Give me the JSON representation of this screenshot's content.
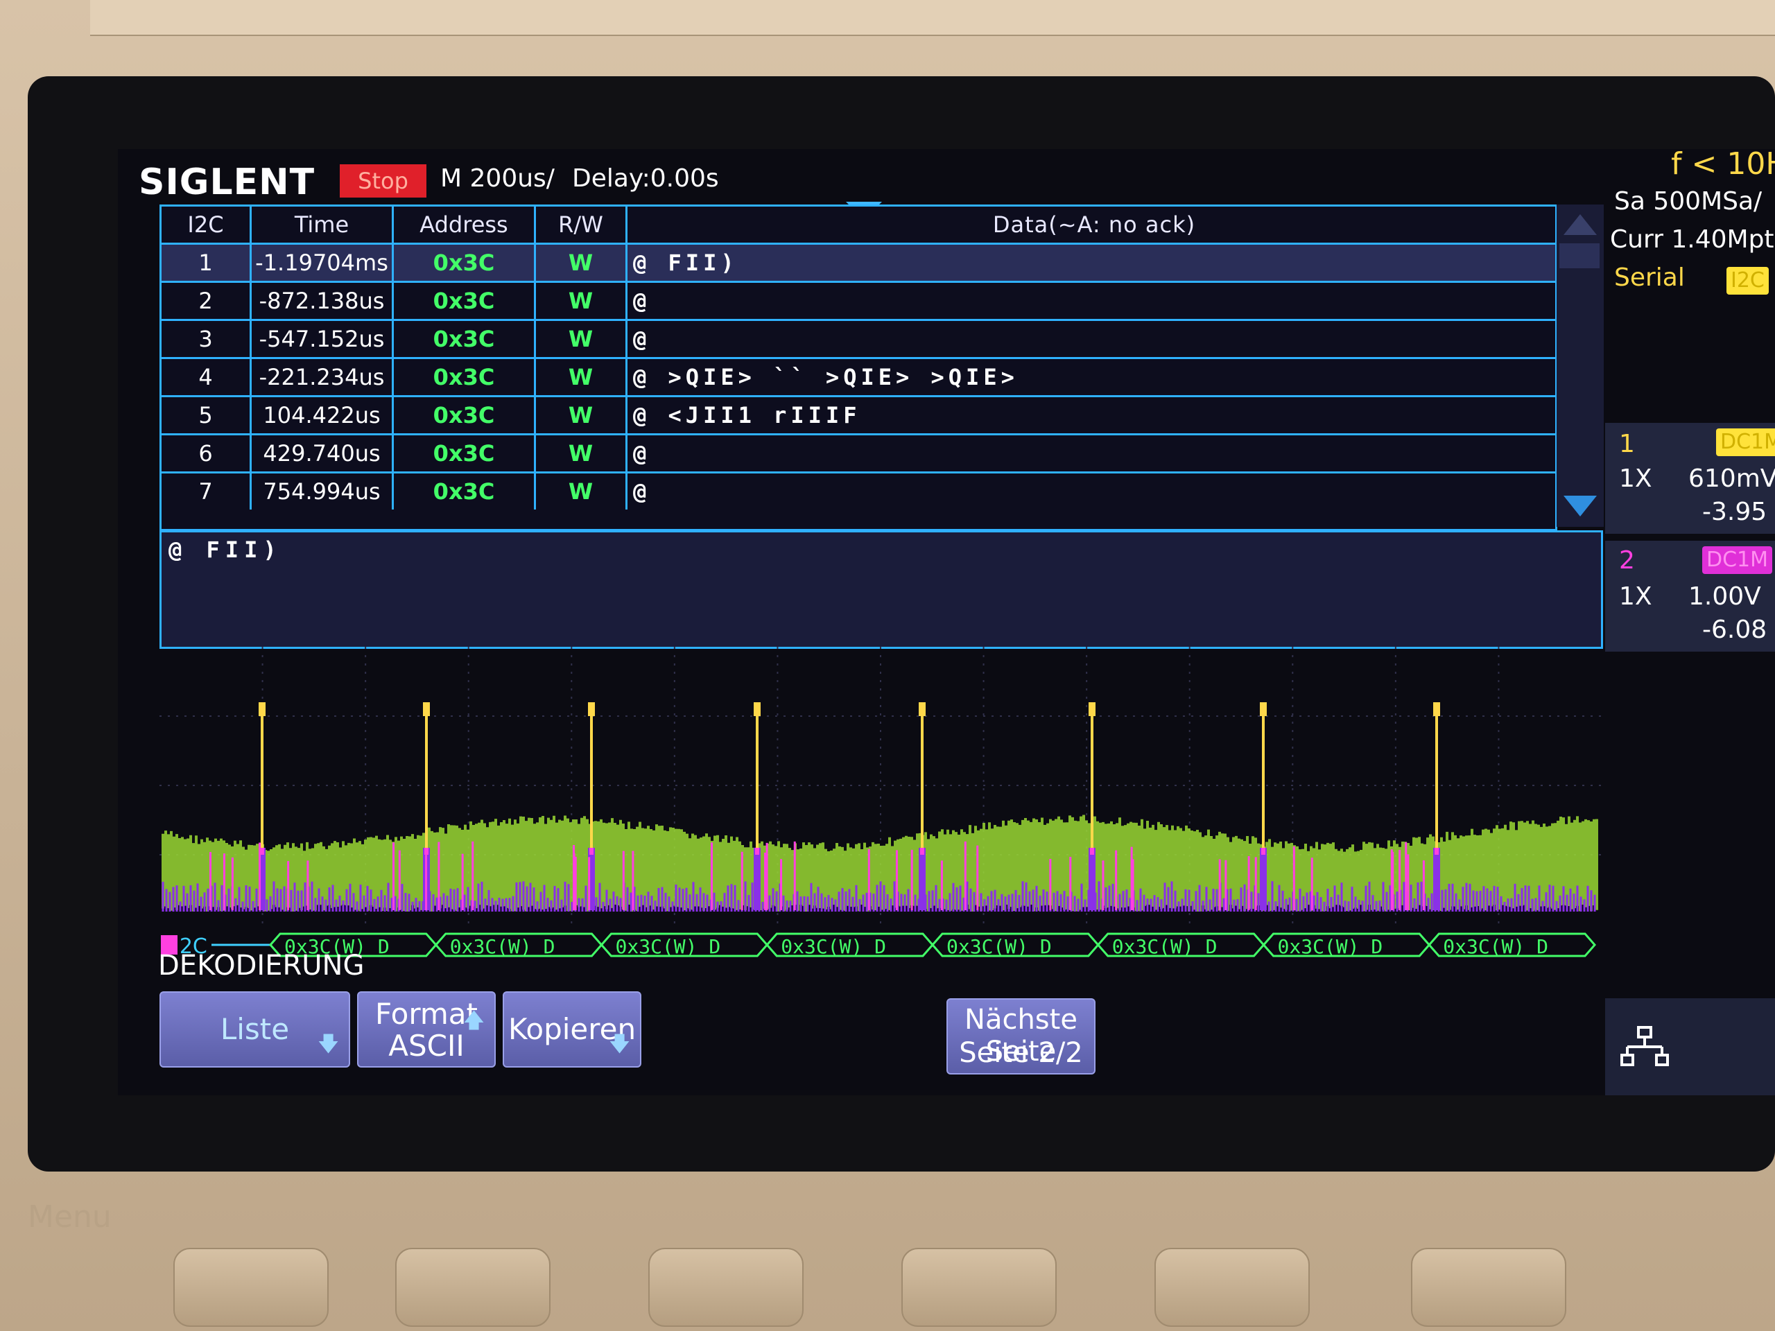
{
  "header": {
    "brand": "SIGLENT",
    "status": "Stop",
    "timebase": "M 200us/",
    "delay": "Delay:0.00s"
  },
  "table": {
    "columns": [
      "I2C",
      "Time",
      "Address",
      "R/W",
      "Data(~A: no ack)"
    ],
    "rows": [
      {
        "no": "1",
        "time": "-1.19704ms",
        "address": "0x3C",
        "rw": "W",
        "data": "@  FII)"
      },
      {
        "no": "2",
        "time": "-872.138us",
        "address": "0x3C",
        "rw": "W",
        "data": "@"
      },
      {
        "no": "3",
        "time": "-547.152us",
        "address": "0x3C",
        "rw": "W",
        "data": "@"
      },
      {
        "no": "4",
        "time": "-221.234us",
        "address": "0x3C",
        "rw": "W",
        "data": "@     >QIE>  ``  >QIE> >QIE>"
      },
      {
        "no": "5",
        "time": "104.422us",
        "address": "0x3C",
        "rw": "W",
        "data": "@ <JII1 rIIIF"
      },
      {
        "no": "6",
        "time": "429.740us",
        "address": "0x3C",
        "rw": "W",
        "data": "@"
      },
      {
        "no": "7",
        "time": "754.994us",
        "address": "0x3C",
        "rw": "W",
        "data": "@"
      }
    ]
  },
  "detail": {
    "text": "@  FII)"
  },
  "decode_bus": {
    "label": "I2C",
    "segment": "0x3C(W) D",
    "segment_count": 8
  },
  "softkeys": {
    "title": "DEKODIERUNG",
    "list": "Liste",
    "format_line1": "Format",
    "format_line2": "ASCII",
    "copy": "Kopieren",
    "next_line1": "Nächste Seite",
    "next_line2": "Seite 2/2"
  },
  "right_panel": {
    "freq": "f < 10H",
    "sample_rate": "Sa 500MSa/",
    "memory": "Curr 1.40Mpt",
    "trigger_type": "Serial",
    "trigger_badge": "I2C",
    "ch1": {
      "num": "1",
      "coupling": "DC1M",
      "probe": "1X",
      "scale": "610mV",
      "offset": "-3.95"
    },
    "ch2": {
      "num": "2",
      "coupling": "DC1M",
      "probe": "1X",
      "scale": "1.00V",
      "offset": "-6.08"
    }
  },
  "front_panel": {
    "menu": "Menu"
  },
  "colors": {
    "grid_border": "#2fb1ff",
    "ch1_yellow": "#ffd84a",
    "ch2_magenta": "#ff40e0",
    "address_green": "#43ff68",
    "trace_green": "#9ad834",
    "trace_purple": "#8a30e8",
    "stop_red": "#e0202a"
  }
}
